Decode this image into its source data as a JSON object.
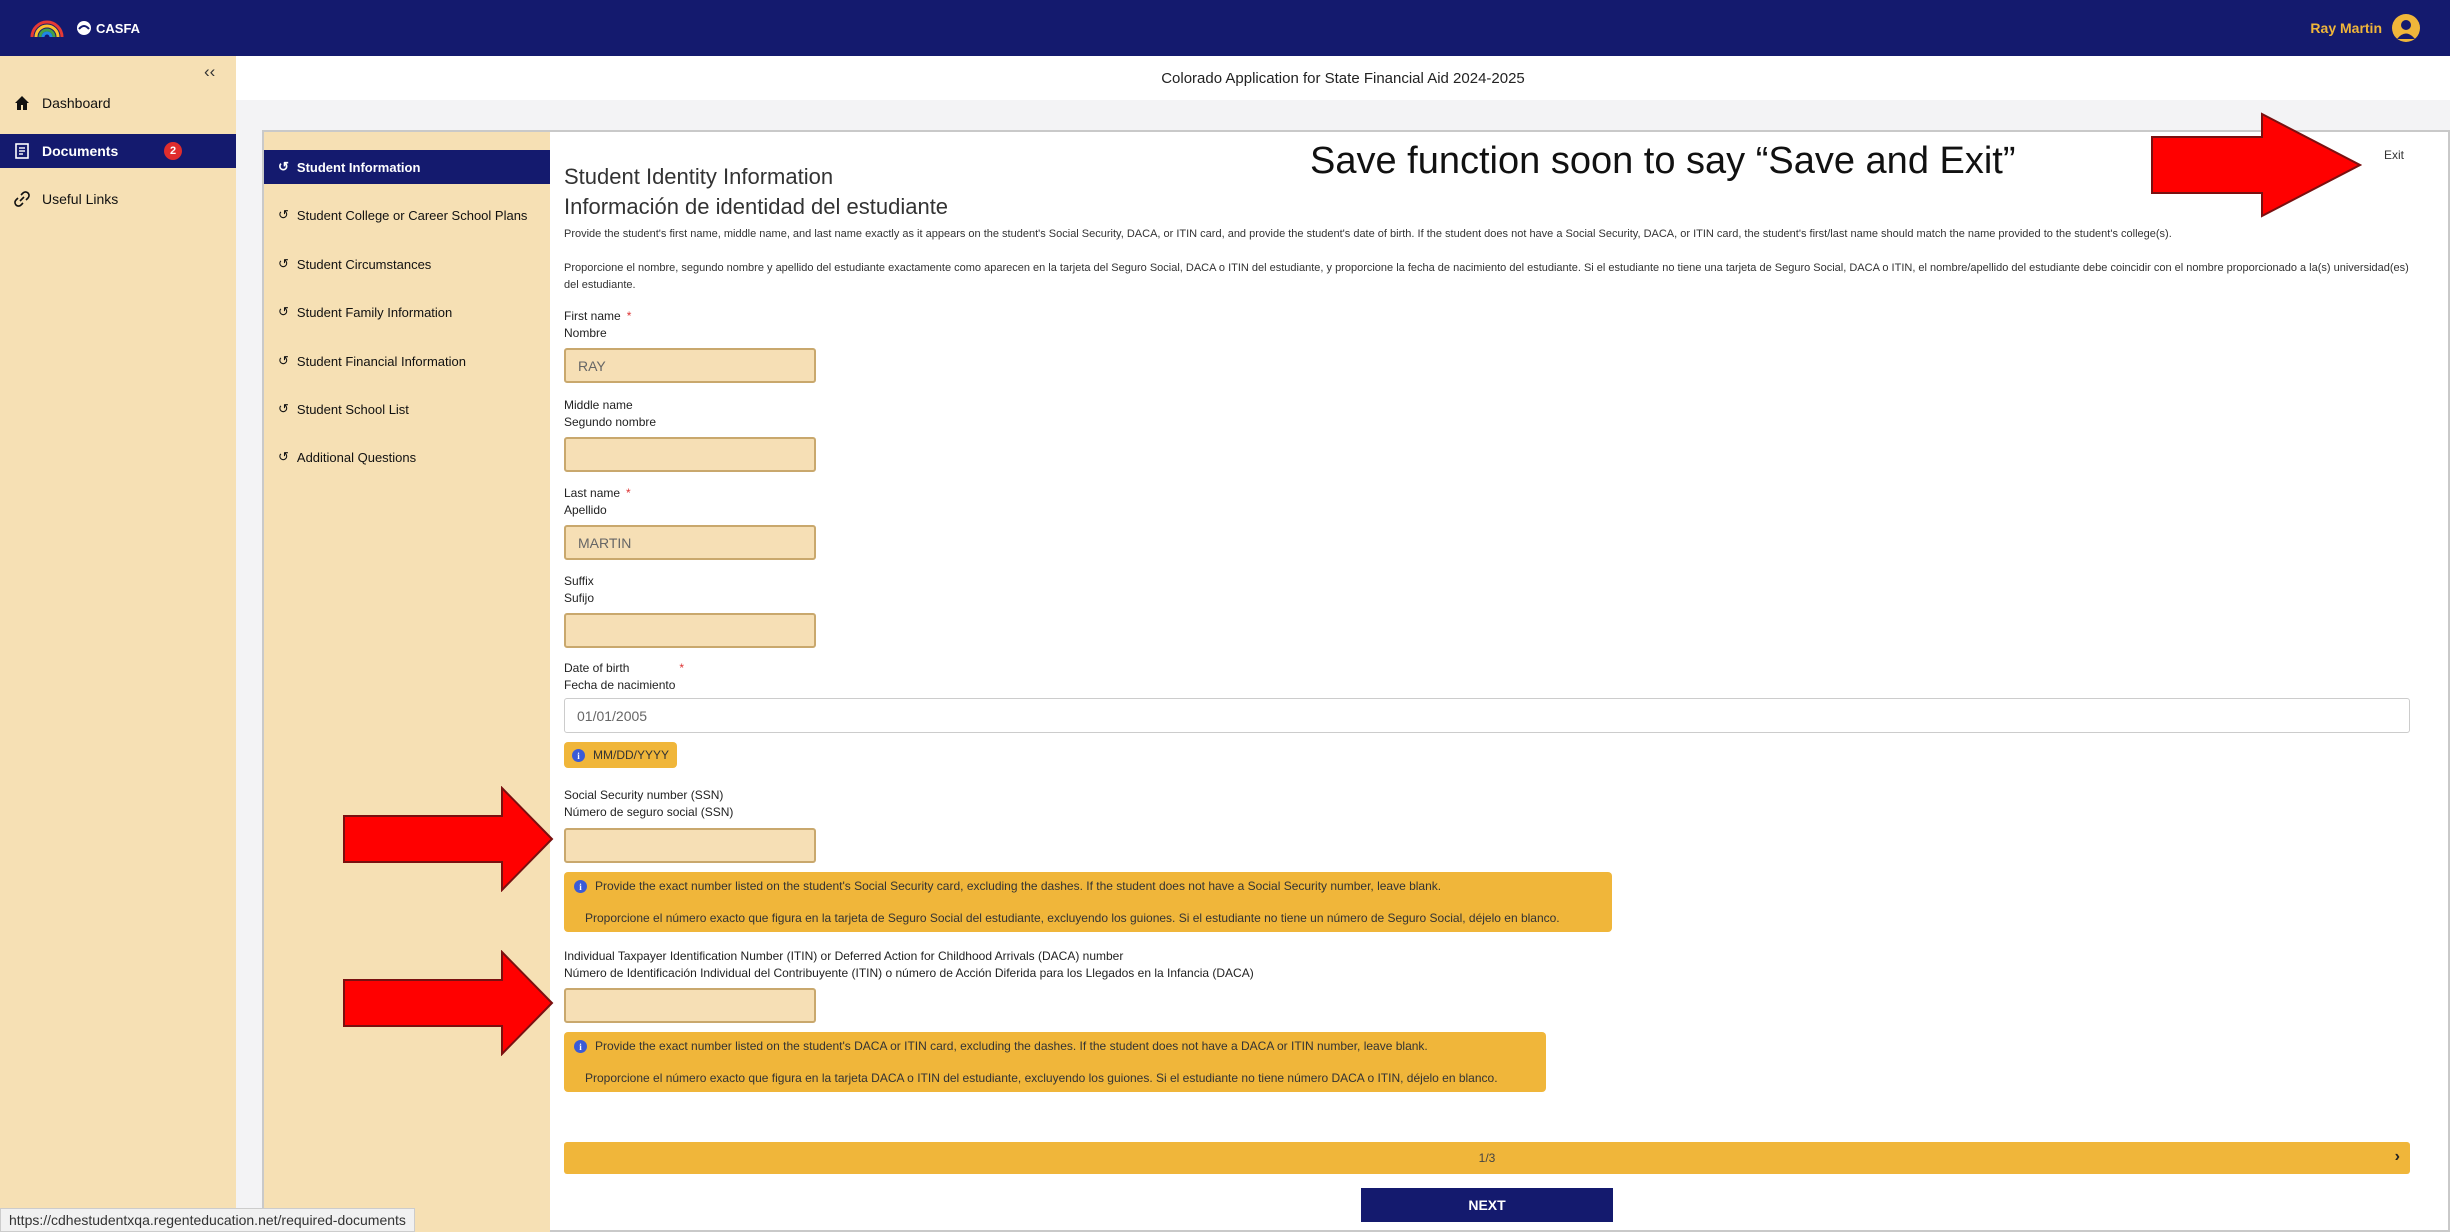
{
  "header": {
    "logo_text": "CASFA",
    "user_name": "Ray Martin",
    "page_title": "Colorado Application for State Financial Aid 2024-2025"
  },
  "sidebar": {
    "collapse_glyph": "‹‹",
    "items": [
      {
        "label": "Dashboard",
        "icon": "home-icon"
      },
      {
        "label": "Documents",
        "icon": "document-icon",
        "badge": "2"
      },
      {
        "label": "Useful Links",
        "icon": "link-icon"
      }
    ]
  },
  "steps": [
    {
      "label": "Student Information",
      "icon": "undo-icon"
    },
    {
      "label": "Student College or Career School Plans",
      "icon": "undo-icon"
    },
    {
      "label": "Student Circumstances",
      "icon": "undo-icon"
    },
    {
      "label": "Student Family Information",
      "icon": "undo-icon"
    },
    {
      "label": "Student Financial Information",
      "icon": "undo-icon"
    },
    {
      "label": "Student School List",
      "icon": "undo-icon"
    },
    {
      "label": "Additional Questions",
      "icon": "undo-icon"
    }
  ],
  "form": {
    "title_en": "Student Identity Information",
    "title_es": "Información de identidad del estudiante",
    "desc_en": "Provide the student's first name, middle name, and last name exactly as it appears on the student's Social Security, DACA, or ITIN card, and provide the student's date of birth. If the student does not have a Social Security, DACA, or ITIN card, the student's first/last name should match the name provided to the student's college(s).",
    "desc_es": "Proporcione el nombre, segundo nombre y apellido del estudiante exactamente como aparecen en la tarjeta del Seguro Social, DACA o ITIN del estudiante, y proporcione la fecha de nacimiento del estudiante. Si el estudiante no tiene una tarjeta de Seguro Social, DACA o ITIN, el nombre/apellido del estudiante debe coincidir con el nombre proporcionado a la(s) universidad(es) del estudiante.",
    "first_name": {
      "label_en": "First name",
      "label_es": "Nombre",
      "value": "RAY",
      "required": "*"
    },
    "middle_name": {
      "label_en": "Middle name",
      "label_es": "Segundo nombre",
      "value": ""
    },
    "last_name": {
      "label_en": "Last name",
      "label_es": "Apellido",
      "value": "MARTIN",
      "required": "*"
    },
    "suffix": {
      "label_en": "Suffix",
      "label_es": "Sufijo",
      "value": ""
    },
    "dob": {
      "label_en": "Date of birth",
      "label_es": "Fecha de nacimiento",
      "value": "01/01/2005",
      "required": "*",
      "format_hint": "MM/DD/YYYY"
    },
    "ssn": {
      "label_en": "Social Security number (SSN)",
      "label_es": "Número de seguro social (SSN)",
      "value": "",
      "hint_en": "Provide the exact number listed on the student's Social Security card, excluding the dashes. If the student does not have a Social Security number, leave blank.",
      "hint_es": "Proporcione el número exacto que figura en la tarjeta de Seguro Social del estudiante, excluyendo los guiones. Si el estudiante no tiene un número de Seguro Social, déjelo en blanco."
    },
    "itin": {
      "label_en": "Individual Taxpayer Identification Number (ITIN) or Deferred Action for Childhood Arrivals (DACA) number",
      "label_es": "Número de Identificación Individual del Contribuyente (ITIN) o número de Acción Diferida para los Llegados en la Infancia (DACA)",
      "value": "",
      "hint_en": "Provide the exact number listed on the student's DACA or ITIN card, excluding the dashes. If the student does not have a DACA or ITIN number, leave blank.",
      "hint_es": "Proporcione el número exacto que figura en la tarjeta DACA o ITIN del estudiante, excluyendo los guiones. Si el estudiante no tiene número DACA o ITIN, déjelo en blanco."
    },
    "pager_text": "1/3",
    "next_label": "NEXT",
    "exit_label": "Exit"
  },
  "annotation_text": "Save function soon to say “Save and Exit”",
  "status_url": "https://cdhestudentxqa.regenteducation.net/required-documents",
  "colors": {
    "navy": "#141a6e",
    "tan": "#f6e0b4",
    "gold": "#f0b63a",
    "arrow_red": "#ff0000"
  }
}
